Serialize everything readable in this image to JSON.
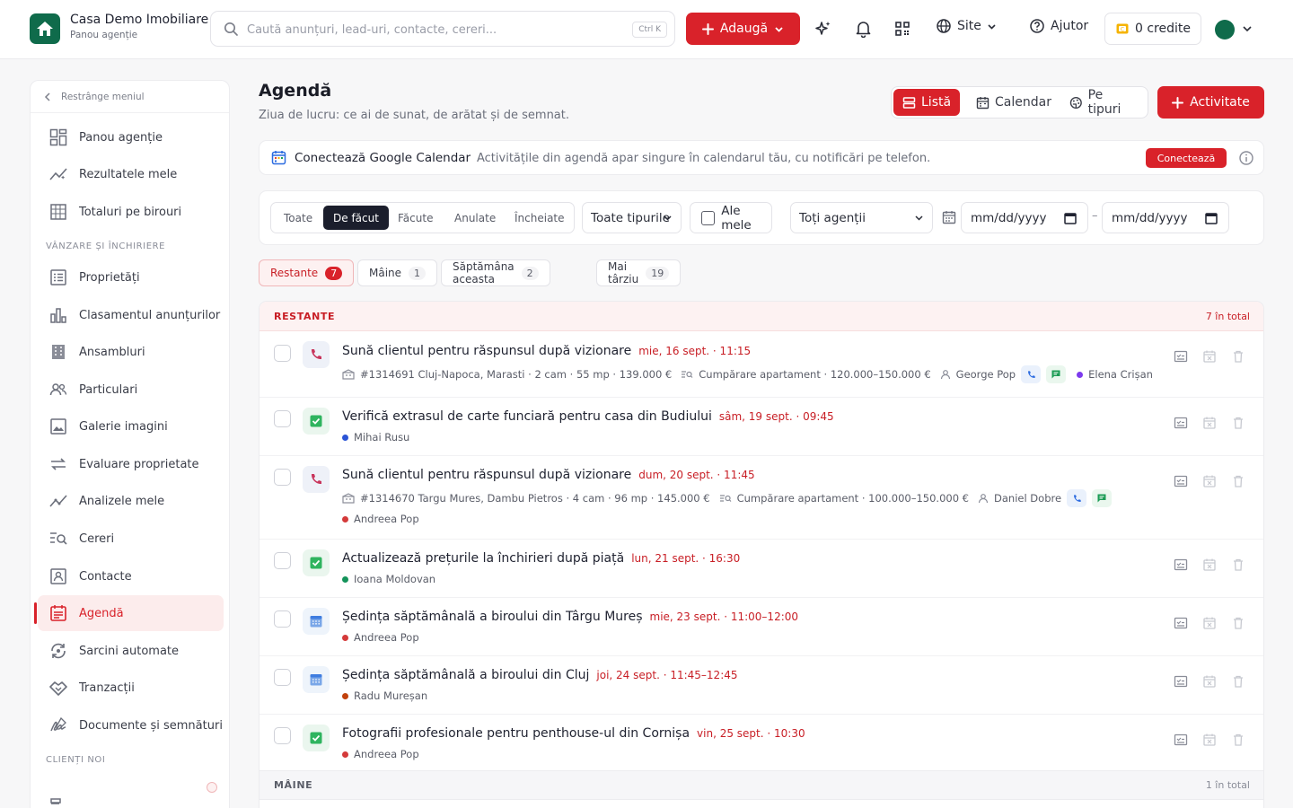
{
  "header": {
    "brand_name": "Casa Demo Imobiliare",
    "brand_sub": "Panou agenție",
    "search_placeholder": "Caută anunțuri, lead-uri, contacte, cereri...",
    "search_shortcut": "Ctrl K",
    "add_label": "Adaugă",
    "site_label": "Site",
    "help_label": "Ajutor",
    "credits_label": "0  credite"
  },
  "sidebar": {
    "collapse_label": "Restrânge meniul",
    "section_sales": "VÂNZARE ȘI ÎNCHIRIERE",
    "section_clients": "CLIENȚI NOI",
    "items": [
      {
        "label": "Panou agenție",
        "icon": "dashboard-icon"
      },
      {
        "label": "Rezultatele mele",
        "icon": "chart-line-icon"
      },
      {
        "label": "Totaluri pe birouri",
        "icon": "building-icon"
      },
      {
        "label": "Proprietăți",
        "icon": "list-icon"
      },
      {
        "label": "Clasamentul anunțurilor",
        "icon": "bar-chart-icon"
      },
      {
        "label": "Ansambluri",
        "icon": "apartments-icon"
      },
      {
        "label": "Particulari",
        "icon": "users-icon"
      },
      {
        "label": "Galerie imagini",
        "icon": "image-icon"
      },
      {
        "label": "Evaluare proprietate",
        "icon": "compare-icon"
      },
      {
        "label": "Analizele mele",
        "icon": "analytics-icon"
      },
      {
        "label": "Cereri",
        "icon": "search-list-icon"
      },
      {
        "label": "Contacte",
        "icon": "contact-card-icon"
      },
      {
        "label": "Agendă",
        "icon": "agenda-icon"
      },
      {
        "label": "Sarcini automate",
        "icon": "automation-icon"
      },
      {
        "label": "Tranzacții",
        "icon": "handshake-icon"
      },
      {
        "label": "Documente și semnături",
        "icon": "signature-icon"
      }
    ]
  },
  "page": {
    "title": "Agendă",
    "subtitle": "Ziua de lucru: ce ai de sunat, de arătat și de semnat.",
    "view_list": "Listă",
    "view_calendar": "Calendar",
    "view_types": "Pe tipuri",
    "add_activity": "Activitate"
  },
  "gcal": {
    "title": "Conectează Google Calendar",
    "desc": "Activitățile din agendă apar singure în calendarul tău, cu notificări pe telefon.",
    "button": "Conectează"
  },
  "filters": {
    "status": [
      "Toate",
      "De făcut",
      "Făcute",
      "Anulate",
      "Încheiate"
    ],
    "status_active": "De făcut",
    "types": "Toate tipurile",
    "mine": "Ale mele",
    "agents": "Toți agenții",
    "date_from": "mm/dd/yyyy",
    "date_to": "mm/dd/yyyy"
  },
  "chips": [
    {
      "label": "Restante",
      "count": "7"
    },
    {
      "label": "Mâine",
      "count": "1"
    },
    {
      "label": "Săptămâna aceasta",
      "count": "2"
    },
    {
      "label": "Mai târziu",
      "count": "19"
    }
  ],
  "groups": {
    "overdue_title": "RESTANTE",
    "overdue_total": "7 în total",
    "tomorrow_title": "MÂINE",
    "tomorrow_total": "1 în total"
  },
  "rows": [
    {
      "type": "call",
      "title": "Sună clientul pentru răspunsul după vizionare",
      "date": "mie, 16 sept. · 11:15",
      "property": "#1314691 Cluj-Napoca, Marasti · 2 cam · 55 mp · 139.000 €",
      "request": "Cumpărare apartament · 120.000–150.000 €",
      "contact": "George Pop",
      "owner": "Elena Crișan",
      "owner_color": "#7c3aed"
    },
    {
      "type": "task",
      "title": "Verifică extrasul de carte funciară pentru casa din Budiului",
      "date": "sâm, 19 sept. · 09:45",
      "owner": "Mihai Rusu",
      "owner_color": "#2b54d6"
    },
    {
      "type": "call",
      "title": "Sună clientul pentru răspunsul după vizionare",
      "date": "dum, 20 sept. · 11:45",
      "property": "#1314670 Targu Mures, Dambu Pietros · 4 cam · 96 mp · 145.000 €",
      "request": "Cumpărare apartament · 100.000–150.000 €",
      "contact": "Daniel Dobre",
      "owner": "Andreea Pop",
      "owner_color": "#d43a3a"
    },
    {
      "type": "task",
      "title": "Actualizează prețurile la închirieri după piață",
      "date": "lun, 21 sept. · 16:30",
      "owner": "Ioana Moldovan",
      "owner_color": "#14935a"
    },
    {
      "type": "meet",
      "title": "Ședința săptămânală a biroului din Târgu Mureș",
      "date": "mie, 23 sept. · 11:00–12:00",
      "owner": "Andreea Pop",
      "owner_color": "#d43a3a"
    },
    {
      "type": "meet",
      "title": "Ședința săptămânală a biroului din Cluj",
      "date": "joi, 24 sept. · 11:45–12:45",
      "owner": "Radu Mureșan",
      "owner_color": "#c2410c"
    },
    {
      "type": "task",
      "title": "Fotografii profesionale pentru penthouse-ul din Cornișa",
      "date": "vin, 25 sept. · 10:30",
      "owner": "Andreea Pop",
      "owner_color": "#d43a3a"
    }
  ],
  "colors": {
    "accent": "#d9222a",
    "dark": "#1b1e2c",
    "brand_green": "#0f6b4b"
  }
}
